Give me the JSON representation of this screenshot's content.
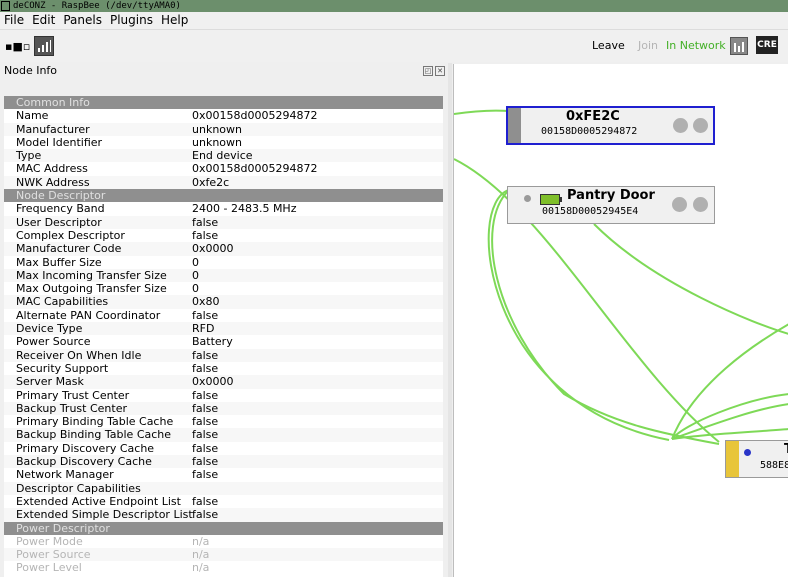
{
  "window": {
    "title": "deCONZ - RaspBee (/dev/ttyAMA0)"
  },
  "menu": [
    "File",
    "Edit",
    "Panels",
    "Plugins",
    "Help"
  ],
  "toolbar": {
    "leave_label": "Leave",
    "join_label": "Join",
    "status_label": "In Network",
    "cre_label": "CRE",
    "status_color": "#43b027"
  },
  "panel": {
    "title": "Node Info",
    "rows": [
      {
        "type": "section",
        "key": "Common Info"
      },
      {
        "key": "Name",
        "value": "0x00158d0005294872"
      },
      {
        "key": "Manufacturer",
        "value": "unknown"
      },
      {
        "key": "Model Identifier",
        "value": "unknown"
      },
      {
        "key": "Type",
        "value": "End device"
      },
      {
        "key": "MAC Address",
        "value": "0x00158d0005294872"
      },
      {
        "key": "NWK Address",
        "value": "0xfe2c"
      },
      {
        "type": "section",
        "key": "Node Descriptor"
      },
      {
        "key": "Frequency Band",
        "value": "2400 - 2483.5 MHz"
      },
      {
        "key": "User Descriptor",
        "value": "false"
      },
      {
        "key": "Complex Descriptor",
        "value": "false"
      },
      {
        "key": "Manufacturer Code",
        "value": "0x0000"
      },
      {
        "key": "Max Buffer Size",
        "value": "0"
      },
      {
        "key": "Max Incoming Transfer Size",
        "value": "0"
      },
      {
        "key": "Max Outgoing Transfer Size",
        "value": "0"
      },
      {
        "key": "MAC Capabilities",
        "value": "0x80"
      },
      {
        "key": "Alternate PAN Coordinator",
        "value": "false"
      },
      {
        "key": "Device Type",
        "value": "RFD"
      },
      {
        "key": "Power Source",
        "value": "Battery"
      },
      {
        "key": "Receiver On When Idle",
        "value": "false"
      },
      {
        "key": "Security Support",
        "value": "false"
      },
      {
        "key": "Server Mask",
        "value": "0x0000"
      },
      {
        "key": "Primary Trust Center",
        "value": "false"
      },
      {
        "key": "Backup Trust Center",
        "value": "false"
      },
      {
        "key": "Primary Binding Table Cache",
        "value": "false"
      },
      {
        "key": "Backup Binding Table Cache",
        "value": "false"
      },
      {
        "key": "Primary Discovery Cache",
        "value": "false"
      },
      {
        "key": "Backup Discovery Cache",
        "value": "false"
      },
      {
        "key": "Network Manager",
        "value": "false"
      },
      {
        "key": "Descriptor Capabilities",
        "value": ""
      },
      {
        "key": "Extended Active Endpoint List",
        "value": "false"
      },
      {
        "key": "Extended Simple Descriptor List",
        "value": "false"
      },
      {
        "type": "section",
        "key": "Power Descriptor"
      },
      {
        "key": "Power Mode",
        "value": "n/a",
        "dim": true
      },
      {
        "key": "Power Source",
        "value": "n/a",
        "dim": true
      },
      {
        "key": "Power Level",
        "value": "n/a",
        "dim": true
      }
    ]
  },
  "nodes": [
    {
      "name": "0xFE2C",
      "mac": "00158D0005294872"
    },
    {
      "name": "Pantry Door",
      "mac": "00158D00052945E4"
    },
    {
      "name": "T",
      "mac": "588E8"
    }
  ],
  "colors": {
    "link": "#7ed957",
    "selected_border": "#1f1fd0",
    "node_bar_yellow": "#e8c53a"
  }
}
